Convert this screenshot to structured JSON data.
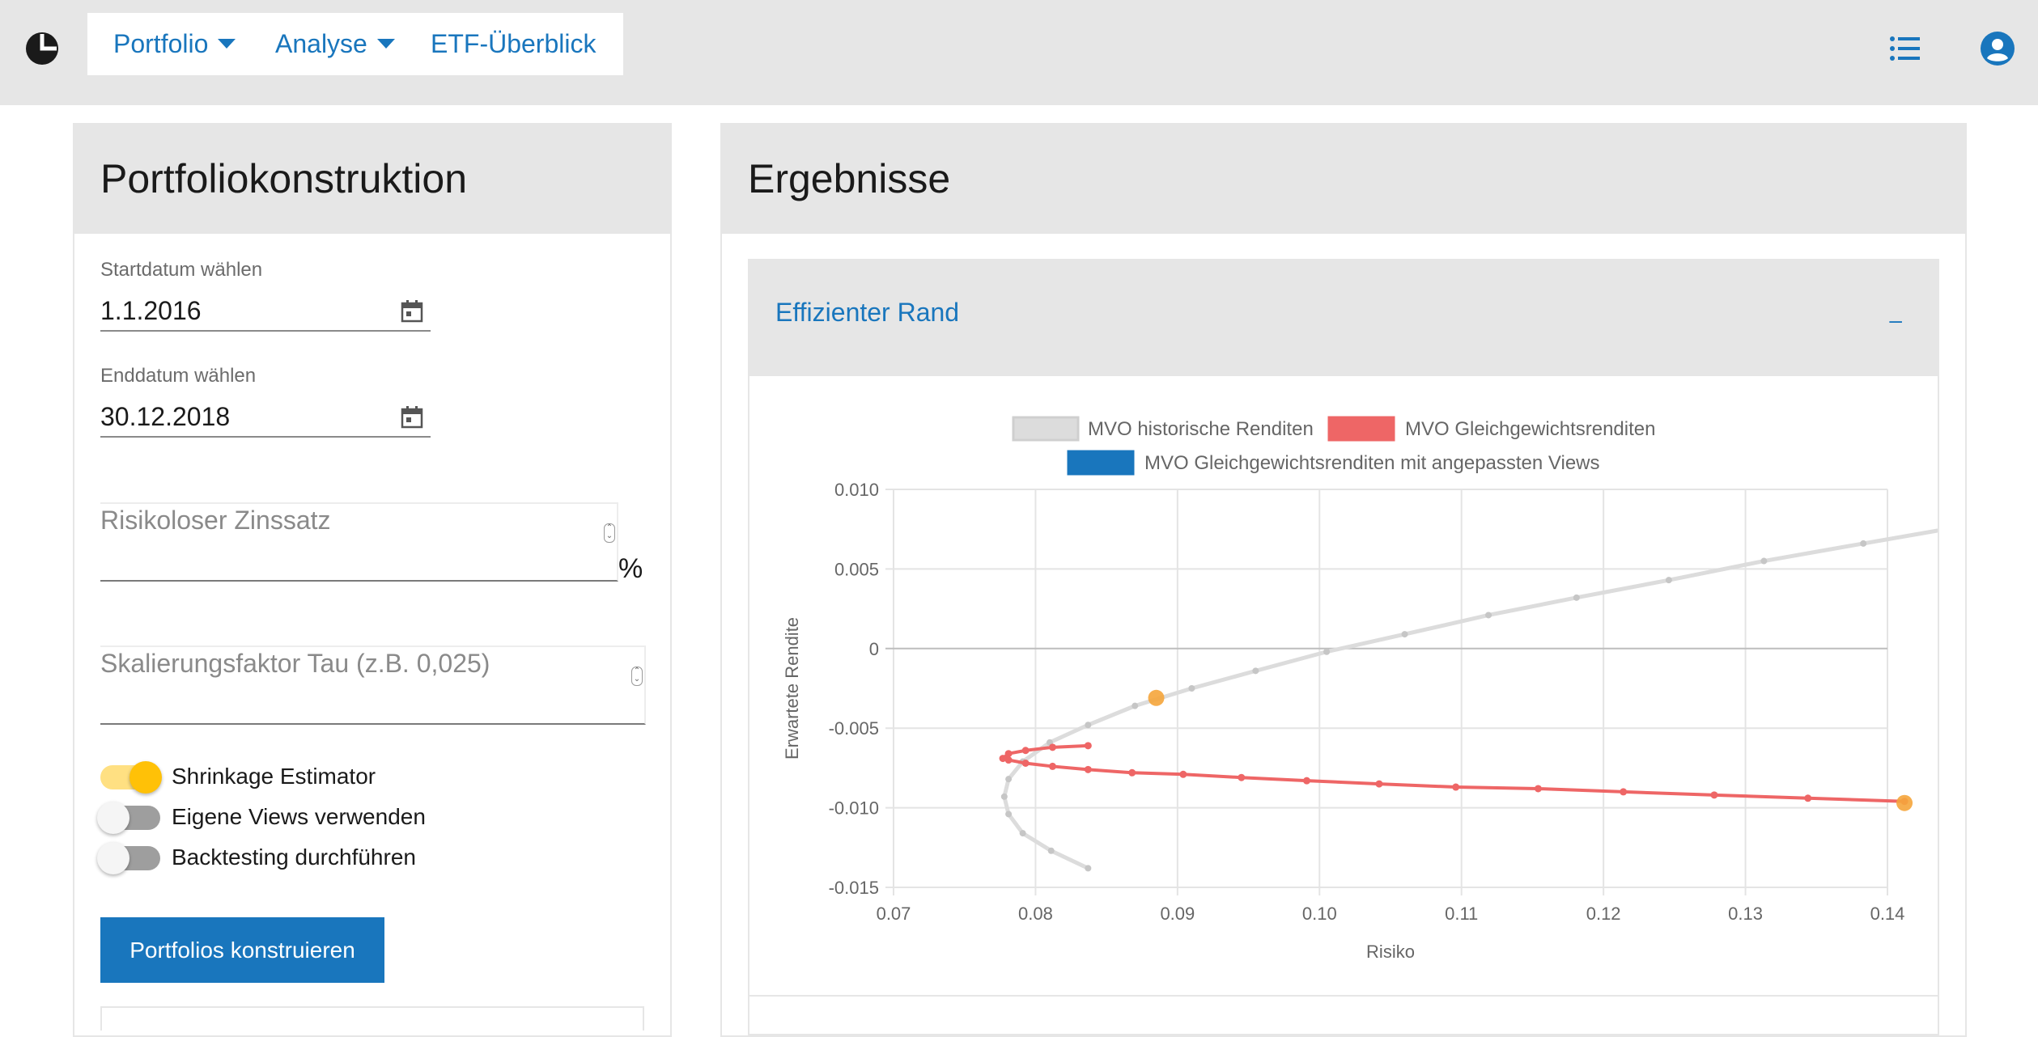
{
  "nav": {
    "items": [
      "Portfolio",
      "Analyse",
      "ETF-Überblick"
    ],
    "icons": [
      "logo-icon",
      "list-icon",
      "account-icon"
    ]
  },
  "left": {
    "title": "Portfoliokonstruktion",
    "start_label": "Startdatum wählen",
    "start_value": "1.1.2016",
    "end_label": "Enddatum wählen",
    "end_value": "30.12.2018",
    "rf_placeholder": "Risikoloser Zinssatz",
    "rf_unit": "%",
    "tau_placeholder": "Skalierungsfaktor Tau (z.B. 0,025)",
    "toggles": [
      {
        "label": "Shrinkage Estimator",
        "on": true
      },
      {
        "label": "Eigene Views verwenden",
        "on": false
      },
      {
        "label": "Backtesting durchführen",
        "on": false
      }
    ],
    "button": "Portfolios konstruieren"
  },
  "right": {
    "title": "Ergebnisse",
    "panel_title": "Effizienter Rand",
    "collapse": "–"
  },
  "colors": {
    "accent": "#1976bd",
    "toggle_on": "#ffc107",
    "series_hist": "#dcdcdc",
    "series_eq": "#ee6666",
    "series_views": "#1976bd",
    "highlight": "#f5a53b"
  },
  "chart_data": {
    "type": "line",
    "xlabel": "Risiko",
    "ylabel": "Erwartete Rendite",
    "xlim": [
      0.07,
      0.14
    ],
    "ylim": [
      -0.015,
      0.01
    ],
    "xticks": [
      "0.07",
      "0.08",
      "0.09",
      "0.10",
      "0.11",
      "0.12",
      "0.13",
      "0.14"
    ],
    "yticks": [
      "0.010",
      "0.005",
      "0",
      "-0.005",
      "-0.010",
      "-0.015"
    ],
    "grid": true,
    "legend_position": "top",
    "series": [
      {
        "name": "MVO historische Renditen",
        "x": [
          0.0837,
          0.0811,
          0.0791,
          0.0781,
          0.0778,
          0.0781,
          0.0791,
          0.081,
          0.0837,
          0.087,
          0.091,
          0.0955,
          0.1005,
          0.106,
          0.1119,
          0.1181,
          0.1246,
          0.1313,
          0.1383,
          0.1454
        ],
        "y": [
          -0.0138,
          -0.0127,
          -0.0116,
          -0.0104,
          -0.0093,
          -0.0082,
          -0.0071,
          -0.0059,
          -0.0048,
          -0.0036,
          -0.0025,
          -0.0014,
          -0.0002,
          0.0009,
          0.0021,
          0.0032,
          0.0043,
          0.0055,
          0.0066,
          0.0077
        ]
      },
      {
        "name": "MVO Gleichgewichtsrenditen",
        "x": [
          0.0837,
          0.0812,
          0.0793,
          0.0781,
          0.0777,
          0.0781,
          0.0793,
          0.0812,
          0.0837,
          0.0868,
          0.0904,
          0.0945,
          0.0991,
          0.1042,
          0.1096,
          0.1154,
          0.1214,
          0.1278,
          0.1344,
          0.1412
        ],
        "y": [
          -0.0061,
          -0.0062,
          -0.0064,
          -0.0066,
          -0.0069,
          -0.007,
          -0.0072,
          -0.0074,
          -0.0076,
          -0.0078,
          -0.0079,
          -0.0081,
          -0.0083,
          -0.0085,
          -0.0087,
          -0.0088,
          -0.009,
          -0.0092,
          -0.0094,
          -0.0096
        ]
      },
      {
        "name": "MVO Gleichgewichtsrenditen mit angepassten Views",
        "x": [],
        "y": []
      }
    ],
    "highlight_points": [
      {
        "x": 0.0885,
        "y": -0.0031
      },
      {
        "x": 0.1412,
        "y": -0.0097
      }
    ]
  }
}
